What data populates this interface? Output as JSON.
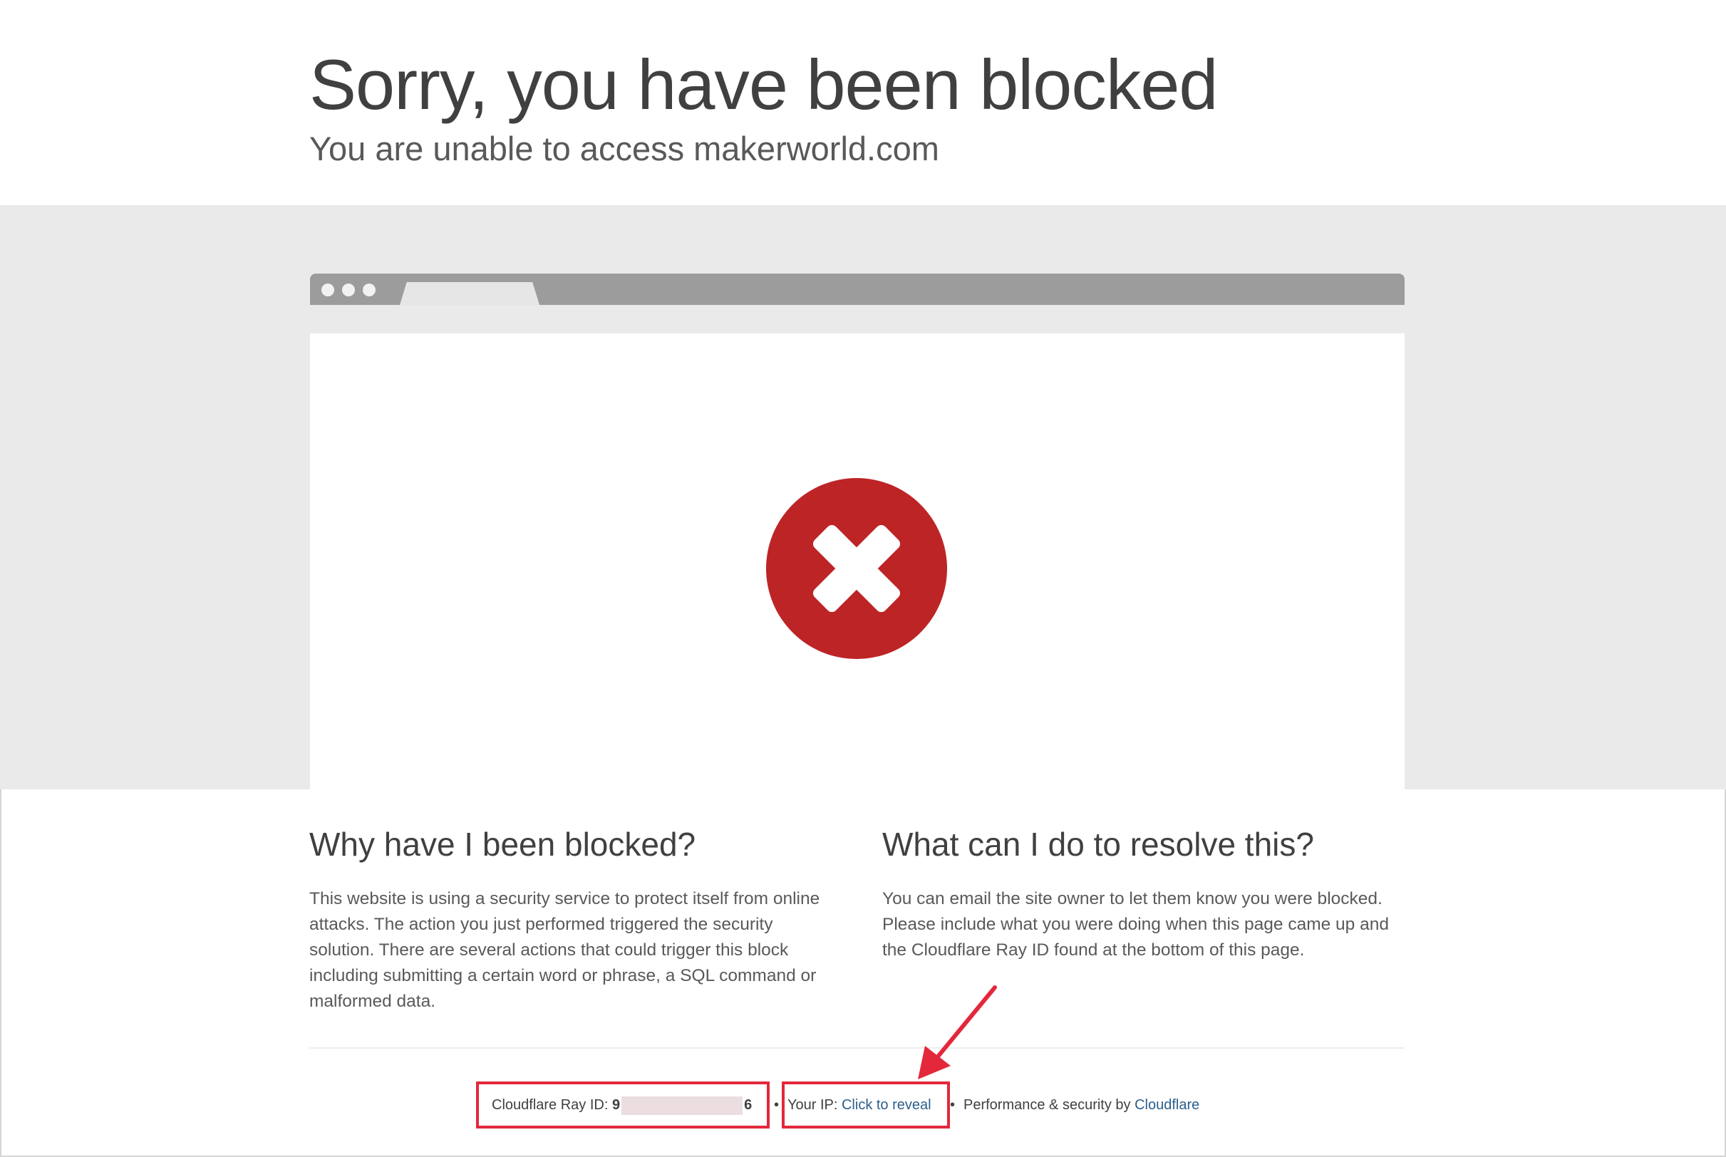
{
  "header": {
    "title": "Sorry, you have been blocked",
    "subtitle": "You are unable to access makerworld.com"
  },
  "illustration": {
    "icon": "error-x-icon",
    "icon_color": "#bd2426",
    "browser_bar_color": "#9c9c9c"
  },
  "why_section": {
    "heading": "Why have I been blocked?",
    "body": "This website is using a security service to protect itself from online attacks. The action you just performed triggered the security solution. There are several actions that could trigger this block including submitting a certain word or phrase, a SQL command or malformed data."
  },
  "resolve_section": {
    "heading": "What can I do to resolve this?",
    "body": "You can email the site owner to let them know you were blocked. Please include what you were doing when this page came up and the Cloudflare Ray ID found at the bottom of this page."
  },
  "footer": {
    "ray_id_label": "Cloudflare Ray ID:",
    "ray_id_start": "9",
    "ray_id_end": "6",
    "separator": "•",
    "ip_label": "Your IP:",
    "ip_link": "Click to reveal",
    "perf_label": "Performance & security by",
    "cloudflare_link": "Cloudflare",
    "link_color": "#2c5f8c"
  },
  "annotations": {
    "highlight_color": "#e3283c"
  }
}
